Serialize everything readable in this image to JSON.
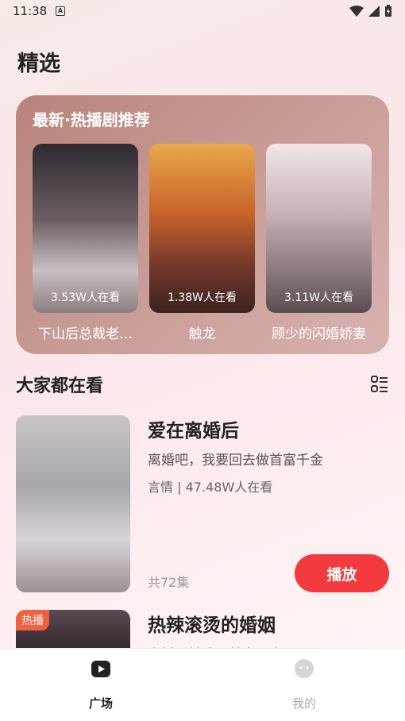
{
  "status": {
    "time": "11:38",
    "a_icon": "A"
  },
  "page_title": "精选",
  "recommend": {
    "title": "最新·热播剧推荐",
    "items": [
      {
        "name": "下山后总裁老…",
        "watching": "3.53W人在看"
      },
      {
        "name": "触龙",
        "watching": "1.38W人在看"
      },
      {
        "name": "顾少的闪婚娇妻",
        "watching": "3.11W人在看"
      }
    ]
  },
  "section": {
    "title": "大家都在看",
    "list_icon": "list-view-icon"
  },
  "dramas": [
    {
      "title": "爱在离婚后",
      "desc": "离婚吧，我要回去做首富千金",
      "meta": "言情 | 47.48W人在看",
      "episodes": "共72集",
      "play_label": "播放"
    },
    {
      "title": "热辣滚烫的婚姻",
      "desc": "离婚后她成了首富千金",
      "badge": "热播"
    }
  ],
  "tabs": [
    {
      "label": "广场",
      "icon": "play-square-icon",
      "active": true
    },
    {
      "label": "我的",
      "icon": "face-icon",
      "active": false
    }
  ],
  "colors": {
    "accent": "#f23a3f",
    "badge": "#f0613f"
  }
}
